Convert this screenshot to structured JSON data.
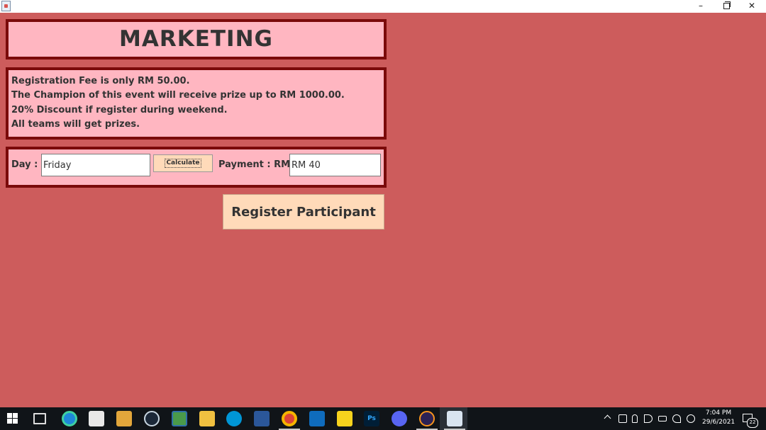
{
  "window": {
    "title": "",
    "controls": {
      "minimize": "–",
      "close": "✕"
    }
  },
  "header": {
    "title": "MARKETING"
  },
  "info": {
    "lines": [
      "Registration Fee is only RM 50.00.",
      "The Champion of this event will receive prize up to RM 1000.00.",
      "20% Discount if register during weekend.",
      "All teams will get prizes."
    ]
  },
  "form": {
    "day_label": "Day :",
    "day_value": "Friday",
    "calculate_label": "Calculate",
    "payment_label": "Payment : RM",
    "payment_value": "RM 40"
  },
  "actions": {
    "register_label": "Register Participant"
  },
  "taskbar": {
    "apps": [
      "start-icon",
      "task-view-icon",
      "edge-icon",
      "store-icon",
      "media-player-icon",
      "steam-icon",
      "photos-icon",
      "file-explorer-icon",
      "hp-icon",
      "word-icon",
      "chrome-icon",
      "mail-icon",
      "sticky-notes-icon",
      "photoshop-icon",
      "discord-icon",
      "eclipse-icon",
      "java-app-icon"
    ],
    "photoshop_text": "Ps",
    "clock_time": "7:04 PM",
    "clock_date": "29/6/2021",
    "notification_count": "22"
  },
  "colors": {
    "background": "#cd5c5c",
    "panel_fill": "#ffb6c1",
    "panel_border": "#7a0a0a",
    "button_fill": "#ffdab9",
    "text": "#333333"
  }
}
